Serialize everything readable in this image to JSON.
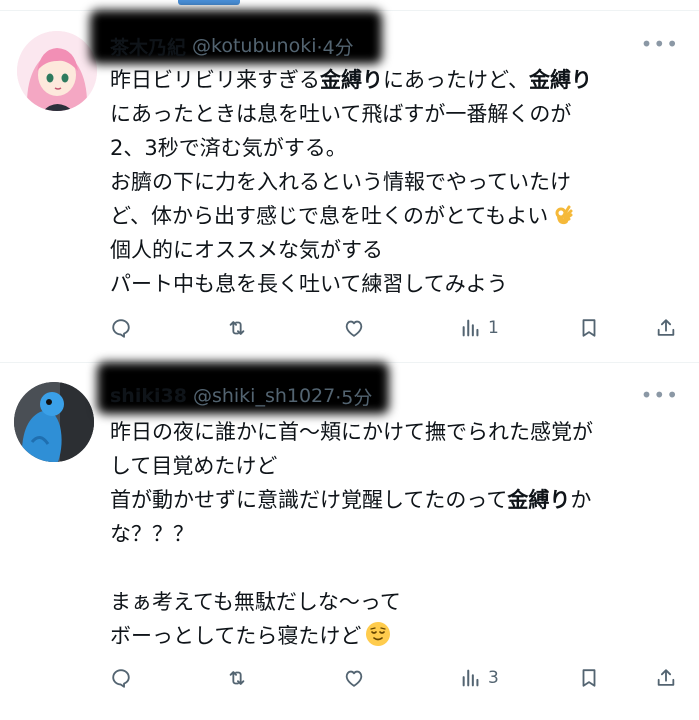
{
  "tweets": [
    {
      "name": "茶木乃紀",
      "handle": "@kotubunoki",
      "time": "·4分",
      "lines": [
        [
          {
            "t": "昨日ビリビリ来すぎる"
          },
          {
            "t": "金縛り",
            "b": true
          },
          {
            "t": "にあったけど、"
          },
          {
            "t": "金縛り",
            "b": true
          }
        ],
        [
          {
            "t": "にあったときは息を吐いて飛ばすが一番解くのが"
          }
        ],
        [
          {
            "t": "2、3秒で済む気がする。"
          }
        ],
        [
          {
            "t": "お臍の下に力を入れるという情報でやっていたけ"
          }
        ],
        [
          {
            "t": "ど、体から出す感じで息を吐くのがとてもよい"
          },
          {
            "emoji": "ok-hand"
          }
        ],
        [
          {
            "t": "個人的にオススメな気がする"
          }
        ],
        [
          {
            "t": "パート中も息を長く吐いて練習してみよう"
          }
        ]
      ],
      "views": "1"
    },
    {
      "name": "shiki38",
      "handle": "@shiki_sh1027",
      "time": "·5分",
      "lines": [
        [
          {
            "t": "昨日の夜に誰かに首〜頬にかけて撫でられた感覚が"
          }
        ],
        [
          {
            "t": "して目覚めたけど"
          }
        ],
        [
          {
            "t": "首が動かせずに意識だけ覚醒してたのって"
          },
          {
            "t": "金縛り",
            "b": true
          },
          {
            "t": "か"
          }
        ],
        [
          {
            "t": "な？？？"
          }
        ],
        [
          {
            "t": ""
          }
        ],
        [
          {
            "t": "まぁ考えても無駄だしな〜って"
          }
        ],
        [
          {
            "t": "ボーっとしてたら寝たけど"
          },
          {
            "emoji": "relieved-face"
          }
        ]
      ],
      "views": "3"
    }
  ],
  "more_label": "•••",
  "icons": [
    "reply-icon",
    "retweet-icon",
    "like-icon",
    "views-icon",
    "bookmark-icon",
    "share-icon"
  ],
  "colors": {
    "text": "#0f1419",
    "secondary": "#536471",
    "divider": "#eff3f4",
    "accent": "#4a90d9"
  }
}
